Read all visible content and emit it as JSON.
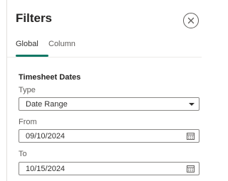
{
  "panel": {
    "title": "Filters",
    "close_icon": "close-icon"
  },
  "tabs": [
    {
      "label": "Global",
      "active": true
    },
    {
      "label": "Column",
      "active": false
    }
  ],
  "section": {
    "title": "Timesheet Dates"
  },
  "fields": {
    "type": {
      "label": "Type",
      "value": "Date Range"
    },
    "from": {
      "label": "From",
      "value": "09/10/2024"
    },
    "to": {
      "label": "To",
      "value": "10/15/2024"
    }
  },
  "colors": {
    "accent": "#117865",
    "border": "#8a8886"
  }
}
